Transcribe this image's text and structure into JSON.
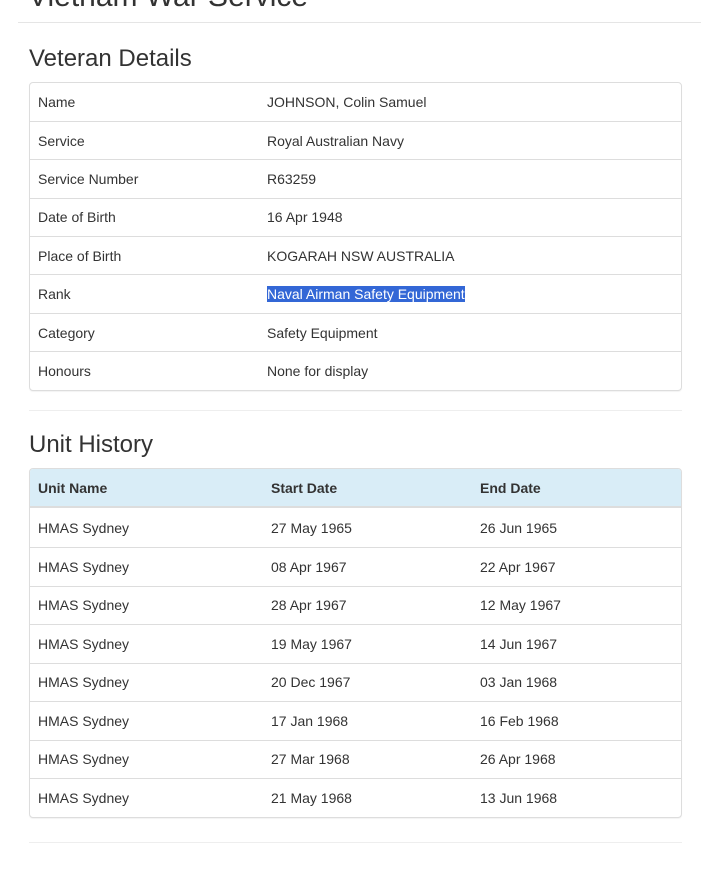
{
  "page": {
    "title": "Vietnam War Service"
  },
  "veteran_details": {
    "heading": "Veteran Details",
    "rows": [
      {
        "label": "Name",
        "value": "JOHNSON, Colin Samuel"
      },
      {
        "label": "Service",
        "value": "Royal Australian Navy"
      },
      {
        "label": "Service Number",
        "value": "R63259"
      },
      {
        "label": "Date of Birth",
        "value": "16 Apr 1948"
      },
      {
        "label": "Place of Birth",
        "value": "KOGARAH NSW AUSTRALIA"
      },
      {
        "label": "Rank",
        "value": "Naval Airman Safety Equipment"
      },
      {
        "label": "Category",
        "value": "Safety Equipment"
      },
      {
        "label": "Honours",
        "value": "None for display"
      }
    ]
  },
  "unit_history": {
    "heading": "Unit History",
    "columns": [
      "Unit Name",
      "Start Date",
      "End Date"
    ],
    "rows": [
      {
        "unit": "HMAS Sydney",
        "start": "27 May 1965",
        "end": "26 Jun 1965"
      },
      {
        "unit": "HMAS Sydney",
        "start": "08 Apr 1967",
        "end": "22 Apr 1967"
      },
      {
        "unit": "HMAS Sydney",
        "start": "28 Apr 1967",
        "end": "12 May 1967"
      },
      {
        "unit": "HMAS Sydney",
        "start": "19 May 1967",
        "end": "14 Jun 1967"
      },
      {
        "unit": "HMAS Sydney",
        "start": "20 Dec 1967",
        "end": "03 Jan 1968"
      },
      {
        "unit": "HMAS Sydney",
        "start": "17 Jan 1968",
        "end": "16 Feb 1968"
      },
      {
        "unit": "HMAS Sydney",
        "start": "27 Mar 1968",
        "end": "26 Apr 1968"
      },
      {
        "unit": "HMAS Sydney",
        "start": "21 May 1968",
        "end": "13 Jun 1968"
      }
    ]
  },
  "colors": {
    "header_row_bg": "#d9edf7",
    "selection_bg": "#3367d6",
    "border": "#dddddd"
  }
}
